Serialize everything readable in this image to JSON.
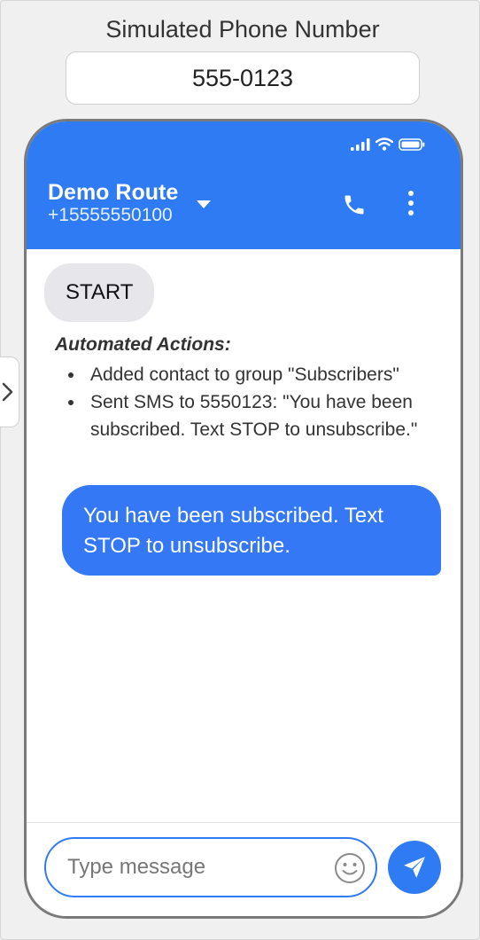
{
  "simulator": {
    "label": "Simulated Phone Number",
    "phone_value": "555-0123"
  },
  "header": {
    "contact_name": "Demo Route",
    "contact_number": "+15555550100"
  },
  "messages": {
    "incoming": "START",
    "actions_title": "Automated Actions:",
    "actions": [
      "Added contact to group \"Subscribers\"",
      "Sent SMS to 5550123: \"You have been subscribed. Text STOP to unsubscribe.\""
    ],
    "outgoing": "You have been subscribed. Text STOP to unsubscribe."
  },
  "composer": {
    "placeholder": "Type message"
  },
  "icons": {
    "side_toggle": "chevron-right-icon",
    "signal": "signal-icon",
    "wifi": "wifi-icon",
    "battery": "battery-icon",
    "dropdown": "caret-down-icon",
    "call": "phone-icon",
    "more": "more-vertical-icon",
    "emoji": "smiley-icon",
    "send": "send-icon"
  },
  "colors": {
    "accent": "#2f7bf3",
    "outgoing_bubble": "#3478f6",
    "incoming_bubble": "#e6e6eb"
  }
}
